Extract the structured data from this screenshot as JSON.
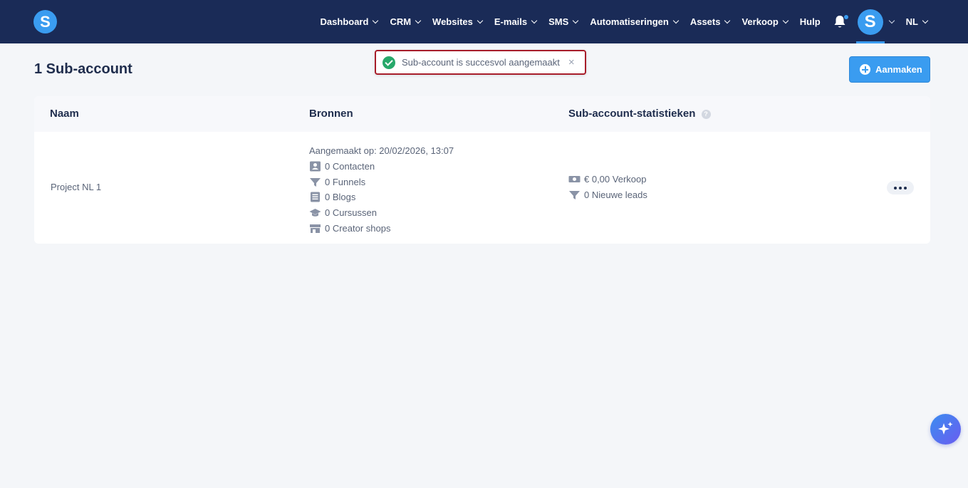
{
  "nav": {
    "logo_letter": "S",
    "items": [
      {
        "label": "Dashboard",
        "has_dropdown": true
      },
      {
        "label": "CRM",
        "has_dropdown": true
      },
      {
        "label": "Websites",
        "has_dropdown": true
      },
      {
        "label": "E-mails",
        "has_dropdown": true
      },
      {
        "label": "SMS",
        "has_dropdown": true
      },
      {
        "label": "Automatiseringen",
        "has_dropdown": true
      },
      {
        "label": "Assets",
        "has_dropdown": true
      },
      {
        "label": "Verkoop",
        "has_dropdown": true
      },
      {
        "label": "Hulp",
        "has_dropdown": false
      }
    ],
    "avatar_letter": "S",
    "language": "NL"
  },
  "toast": {
    "message": "Sub-account is succesvol aangemaakt",
    "close": "×"
  },
  "page": {
    "title": "1 Sub-account",
    "create_button": "Aanmaken"
  },
  "table": {
    "headers": {
      "name": "Naam",
      "sources": "Bronnen",
      "stats": "Sub-account-statistieken",
      "help": "?"
    },
    "row": {
      "name": "Project NL 1",
      "created": "Aangemaakt op: 20/02/2026, 13:07",
      "sources": [
        {
          "icon": "contacts-icon",
          "text": "0 Contacten"
        },
        {
          "icon": "funnel-icon",
          "text": "0 Funnels"
        },
        {
          "icon": "blog-icon",
          "text": "0 Blogs"
        },
        {
          "icon": "graduation-cap-icon",
          "text": "0 Cursussen"
        },
        {
          "icon": "shop-icon",
          "text": "0 Creator shops"
        }
      ],
      "stats": [
        {
          "icon": "money-icon",
          "text": "€ 0,00 Verkoop"
        },
        {
          "icon": "funnel-icon",
          "text": "0 Nieuwe leads"
        }
      ]
    }
  },
  "colors": {
    "topbar": "#1a2b57",
    "accent": "#3a9cf0",
    "success": "#27a86a",
    "toast_border": "#a71d2a"
  }
}
